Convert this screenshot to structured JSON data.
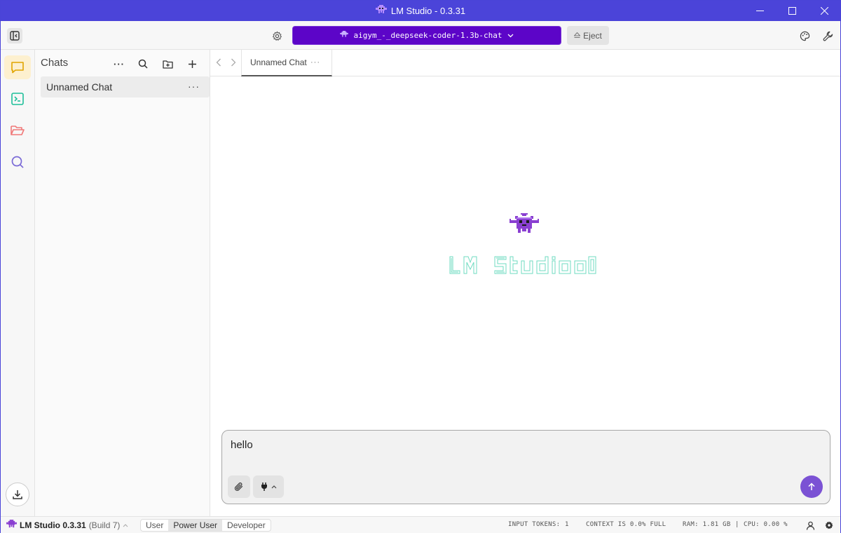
{
  "window": {
    "title": "LM Studio - 0.3.31"
  },
  "toolbar": {
    "model_name": "aigym_-_deepseek-coder-1.3b-chat",
    "eject_label": "Eject"
  },
  "chats_panel": {
    "title": "Chats",
    "items": [
      {
        "label": "Unnamed Chat",
        "menu": "···"
      }
    ],
    "more_label": "···"
  },
  "tabs": [
    {
      "label": "Unnamed Chat",
      "menu": "···"
    }
  ],
  "composer": {
    "input_value": "hello"
  },
  "status_bar": {
    "app_name": "LM Studio 0.3.31",
    "build": "(Build 7)",
    "modes": [
      "User",
      "Power User",
      "Developer"
    ],
    "selected_mode": "Power User",
    "input_tokens_label": "INPUT TOKENS:",
    "input_tokens_value": "1",
    "context_label": "CONTEXT IS 0.0% FULL",
    "ram_label": "RAM: 1.81 GB",
    "separator": "|",
    "cpu_label": "CPU: 0.00 %"
  },
  "colors": {
    "titlebar": "#4b44d9",
    "model_selector": "#5c05c8",
    "accent_purple": "#7b52d4",
    "logo_teal": "#6fdbc0",
    "chat_rail_active": "#fdf0cf"
  },
  "icons": {
    "rail": [
      "chat-icon",
      "terminal-icon",
      "folder-icon",
      "search-icon",
      "download-icon"
    ]
  }
}
